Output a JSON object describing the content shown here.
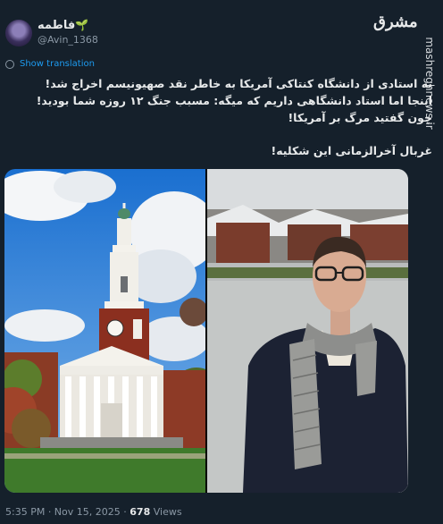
{
  "author": {
    "name": "فاطمه",
    "handle": "@Avin_1368"
  },
  "logo": "مشرق",
  "watermark": "mashreghnews.ir",
  "translate_label": "Show translation",
  "tweet": {
    "line1": "یه استادی از دانشگاه کنتاکی آمریکا به خاطر نقد صهیونیسم اخراج شد!",
    "line2": "اینجا اما استاد دانشگاهی داریم که میگه: مسبب جنگ ۱۲ روزه شما بودید! چون گفتید مرگ بر آمریکا!",
    "line3": "غربال آخرالزمانی این شکلیه!"
  },
  "footer": {
    "time": "5:35 PM · Nov 15, 2025 · ",
    "views_count": "678",
    "views_label": " Views"
  },
  "icons": {
    "leaf": "leaf-icon",
    "translate": "globe-icon"
  },
  "colors": {
    "background": "#15202b",
    "link": "#1d9bf0",
    "muted": "#8b98a5",
    "leaf": "#31c26b"
  }
}
